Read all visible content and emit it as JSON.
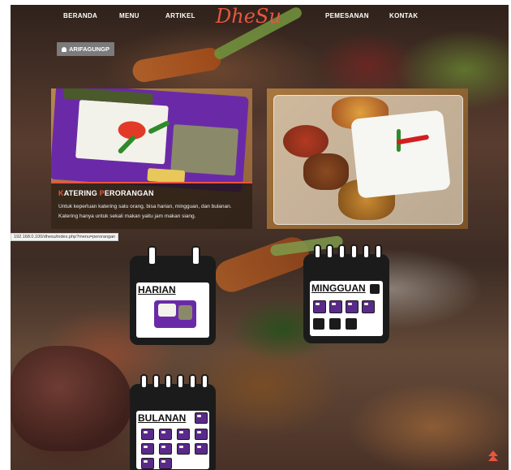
{
  "nav": {
    "items": [
      "BERANDA",
      "MENU",
      "ARTIKEL",
      "PEMESANAN",
      "KONTAK"
    ],
    "logo": {
      "first": "Dhe",
      "middle": "",
      "last": "Su"
    }
  },
  "user": {
    "name": "ARIFAGUNGP"
  },
  "cards": [
    {
      "title_highlight_1": "K",
      "title_rest_1": "ATERING ",
      "title_highlight_2": "P",
      "title_rest_2": "ERORANGAN",
      "desc": "Untuk keperluan katering satu orang, bisa harian, mingguan, dan bulanan. Katering hanya untuk sekali makan yaitu jam makan siang."
    }
  ],
  "status_url": "192.168.0.100/dhesu/index.php?menu=perorangan",
  "calendars": [
    {
      "label": "HARIAN"
    },
    {
      "label": "MINGGUAN"
    },
    {
      "label": "BULANAN"
    }
  ],
  "colors": {
    "accent": "#e8553f",
    "calendar": "#1b1b1b",
    "tray": "#6a2aa8"
  },
  "icons": [
    "user-icon",
    "calendar-icon",
    "scroll-top-icon"
  ]
}
